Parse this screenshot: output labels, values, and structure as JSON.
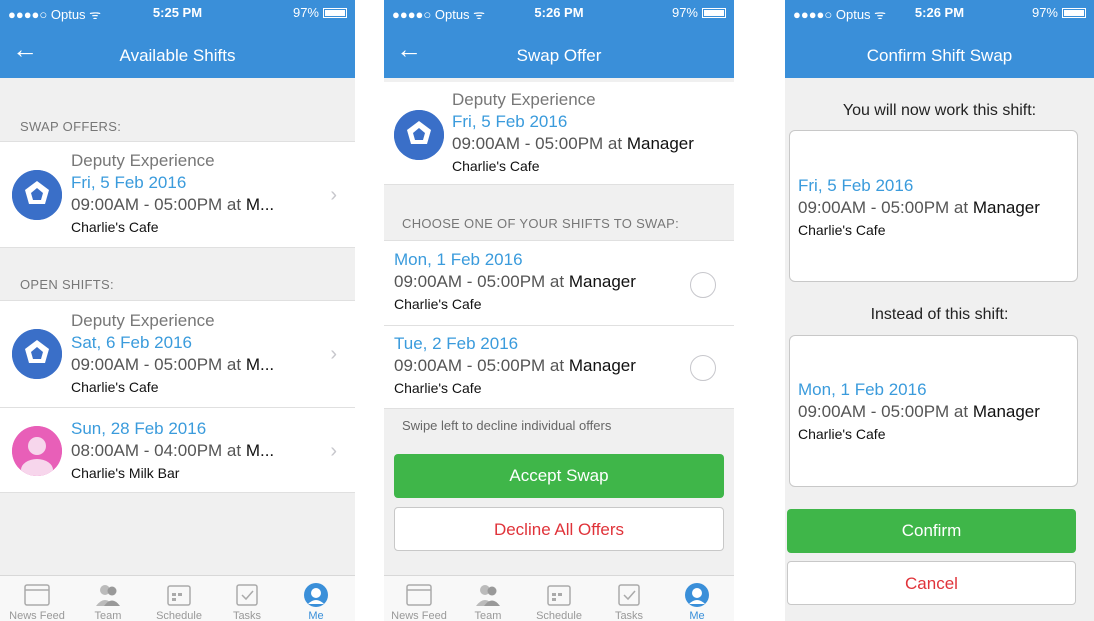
{
  "screens": [
    {
      "status": {
        "carrier": "●●●●○ Optus ᯤ",
        "time": "5:25 PM",
        "battery": "97%"
      },
      "nav": {
        "back_icon": "←",
        "title": "Available Shifts"
      },
      "swap_header": "SWAP OFFERS:",
      "open_header": "OPEN SHIFTS:",
      "swap_offers": [
        {
          "org": "Deputy Experience",
          "date": "Fri, 5 Feb 2016",
          "time": "09:00AM - 05:00PM at ",
          "role": "M...",
          "place": "Charlie's Cafe"
        }
      ],
      "open_shifts": [
        {
          "org": "Deputy Experience",
          "date": "Sat, 6 Feb 2016",
          "time": "09:00AM - 05:00PM at ",
          "role": "M...",
          "place": "Charlie's Cafe"
        },
        {
          "date": "Sun, 28 Feb 2016",
          "time": "08:00AM - 04:00PM at ",
          "role": "M...",
          "place": "Charlie's Milk Bar"
        }
      ],
      "chevron": "›"
    },
    {
      "status": {
        "carrier": "●●●●○ Optus ᯤ",
        "time": "5:26 PM",
        "battery": "97%"
      },
      "nav": {
        "back_icon": "←",
        "title": "Swap Offer"
      },
      "offer": {
        "org": "Deputy Experience",
        "date": "Fri, 5 Feb 2016",
        "time": "09:00AM - 05:00PM at ",
        "role": "Manager",
        "place": "Charlie's Cafe"
      },
      "choose_header": "CHOOSE ONE OF YOUR SHIFTS TO SWAP:",
      "my_shifts": [
        {
          "date": "Mon, 1 Feb 2016",
          "time": "09:00AM - 05:00PM at ",
          "role": "Manager",
          "place": "Charlie's Cafe"
        },
        {
          "date": "Tue, 2 Feb 2016",
          "time": "09:00AM - 05:00PM at ",
          "role": "Manager",
          "place": "Charlie's Cafe"
        }
      ],
      "hint": "Swipe left to decline individual offers",
      "accept_label": "Accept Swap",
      "decline_label": "Decline All Offers"
    },
    {
      "status": {
        "carrier": "●●●●○ Optus ᯤ",
        "time": "5:26 PM",
        "battery": "97%"
      },
      "nav": {
        "title": "Confirm Shift Swap"
      },
      "work_label": "You will now work this shift:",
      "work_shift": {
        "date": "Fri, 5 Feb 2016",
        "time": "09:00AM - 05:00PM at ",
        "role": "Manager",
        "place": "Charlie's Cafe"
      },
      "instead_label": "Instead of this shift:",
      "instead_shift": {
        "date": "Mon, 1 Feb 2016",
        "time": "09:00AM - 05:00PM at ",
        "role": "Manager",
        "place": "Charlie's Cafe"
      },
      "confirm_label": "Confirm",
      "cancel_label": "Cancel"
    }
  ],
  "tabbar": [
    {
      "label": "News Feed",
      "icon": "newsfeed-icon"
    },
    {
      "label": "Team",
      "icon": "team-icon"
    },
    {
      "label": "Schedule",
      "icon": "schedule-icon"
    },
    {
      "label": "Tasks",
      "icon": "tasks-icon"
    },
    {
      "label": "Me",
      "icon": "me-icon",
      "active": true
    }
  ],
  "colors": {
    "brand_blue": "#3a8fd9",
    "link_blue": "#3a9bdc",
    "green": "#3fb649",
    "red": "#e0333a"
  }
}
